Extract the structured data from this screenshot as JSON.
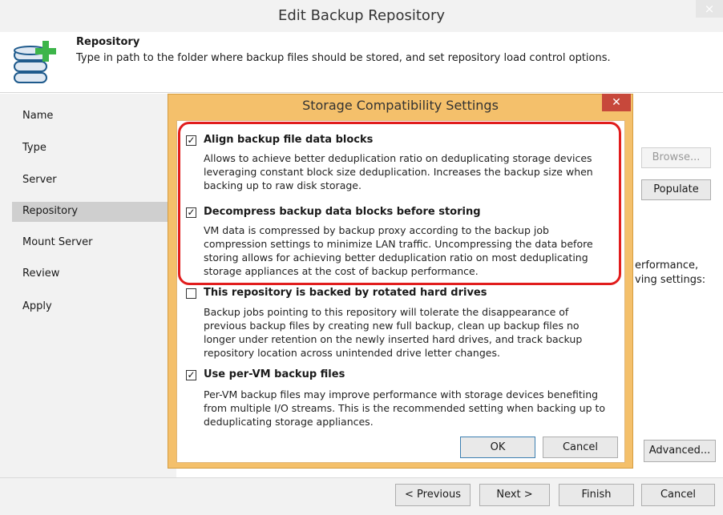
{
  "window": {
    "title": "Edit Backup Repository",
    "close_glyph": "×"
  },
  "header": {
    "icon": "database-add-icon",
    "title": "Repository",
    "description": "Type in path to the folder where backup files should be stored, and set repository load control options."
  },
  "sidebar": {
    "items": [
      {
        "label": "Name"
      },
      {
        "label": "Type"
      },
      {
        "label": "Server"
      },
      {
        "label": "Repository",
        "selected": true
      },
      {
        "label": "Mount Server"
      },
      {
        "label": "Review"
      },
      {
        "label": "Apply"
      }
    ]
  },
  "background": {
    "browse_label": "Browse...",
    "populate_label": "Populate",
    "advanced_label": "Advanced...",
    "partial_text_1": "erformance,",
    "partial_text_2": "ving settings:"
  },
  "footer": {
    "previous_label": "< Previous",
    "next_label": "Next >",
    "finish_label": "Finish",
    "cancel_label": "Cancel"
  },
  "dialog": {
    "title": "Storage Compatibility Settings",
    "close_glyph": "✕",
    "options": [
      {
        "label": "Align backup file data blocks",
        "checked": true,
        "description": [
          "Allows to achieve better deduplication ratio on deduplicating storage devices",
          "leveraging constant block size deduplication. Increases the backup size when",
          "backing up to raw disk storage."
        ]
      },
      {
        "label": "Decompress backup data blocks before storing",
        "checked": true,
        "description": [
          "VM data is compressed by backup proxy according to the backup job",
          "compression settings to minimize LAN traffic. Uncompressing the data before",
          "storing allows for achieving better deduplication ratio on most deduplicating",
          "storage appliances at the cost of backup performance."
        ]
      },
      {
        "label": "This repository is backed by rotated hard drives",
        "checked": false,
        "description": [
          "Backup jobs pointing to this repository will tolerate the disappearance of",
          "previous backup files by creating new full backup, clean up backup files no",
          "longer under retention on the newly inserted hard drives, and track backup",
          "repository location across unintended drive letter changes."
        ]
      },
      {
        "label": "Use per-VM backup files",
        "checked": true,
        "description": [
          "Per-VM backup files may improve performance with storage devices benefiting",
          "from multiple I/O streams. This is the recommended setting when backing up to",
          "deduplicating storage appliances."
        ]
      }
    ],
    "ok_label": "OK",
    "cancel_label": "Cancel",
    "checkmark_glyph": "✓",
    "highlight_color": "#e11d1d"
  }
}
